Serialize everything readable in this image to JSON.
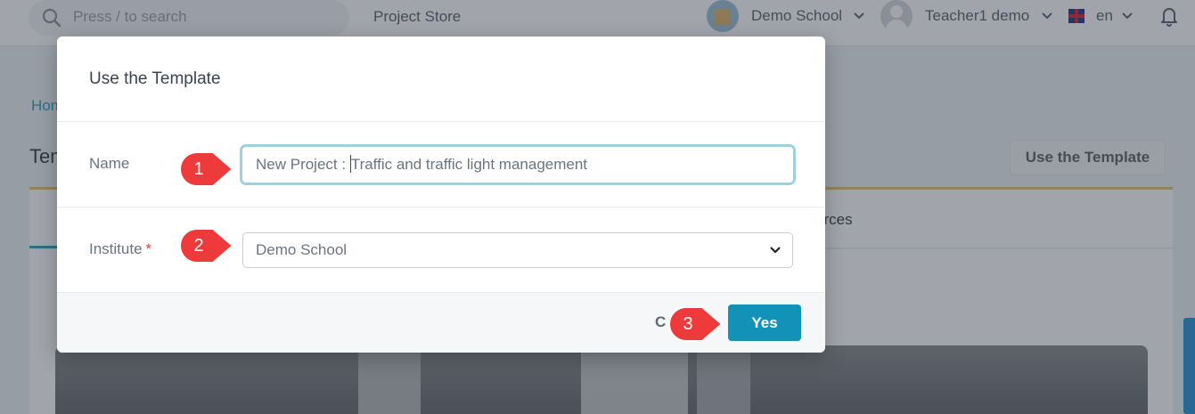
{
  "topbar": {
    "search_placeholder": "Press / to search",
    "store_link": "Project Store",
    "school_name": "Demo School",
    "user_name": "Teacher1 demo",
    "language": "en"
  },
  "background": {
    "breadcrumb": "Hom",
    "page_title": "Tem",
    "use_template_button": "Use the Template",
    "tab_resources": "urces"
  },
  "modal": {
    "title": "Use the Template",
    "name_label": "Name",
    "name_value_before_caret": "New Project : ",
    "name_value_after_caret": "Traffic and traffic light management",
    "institute_label": "Institute",
    "required_mark": "*",
    "institute_selected": "Demo School",
    "cancel_label": "C",
    "yes_label": "Yes"
  },
  "markers": [
    "1",
    "2",
    "3"
  ],
  "colors": {
    "primary": "#1292b6",
    "marker_red": "#ee3a3a",
    "input_focus_border": "#9fd0de",
    "link_blue": "#37a0c6"
  }
}
